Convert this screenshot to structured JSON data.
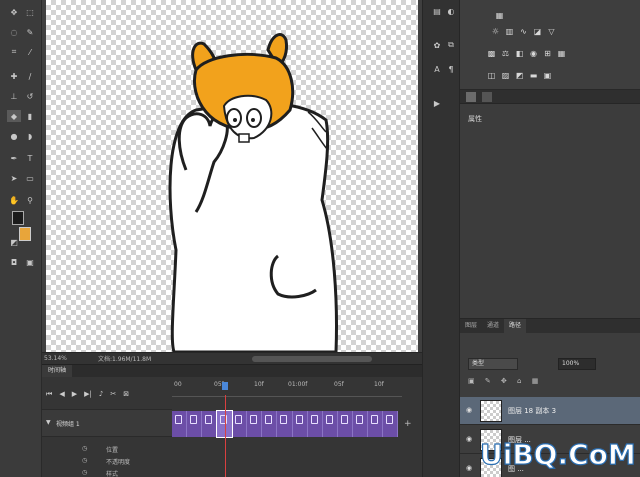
{
  "statusbar": {
    "zoom": "53.14%",
    "doc": "文档:1.96M/11.8M"
  },
  "panels": {
    "properties_title": "属性",
    "layers_tabs": [
      "图层",
      "通道",
      "路径"
    ],
    "layers_filter": "类型",
    "layers_opacity": "100%",
    "layers": [
      {
        "name": "图层 18 副本 3",
        "selected": true
      },
      {
        "name": "图层 ...",
        "selected": false
      },
      {
        "name": "图 ...",
        "selected": false
      }
    ]
  },
  "timeline": {
    "tab": "时间轴",
    "ruler_labels": [
      "00",
      "05f",
      "10f",
      "01:00f",
      "05f",
      "10f"
    ],
    "track_name": "视频组 1",
    "sub_rows": [
      "位置",
      "不透明度",
      "样式"
    ],
    "frame_count": 15,
    "current_frame": 3
  },
  "watermark": {
    "text": "UiBQ.CoM"
  },
  "colors": {
    "foreground": "#1c1c1c",
    "background": "#e8a53a",
    "frame_purple": "#6c4ea7",
    "playhead": "#d94040",
    "layer_selected": "#5b6878"
  }
}
